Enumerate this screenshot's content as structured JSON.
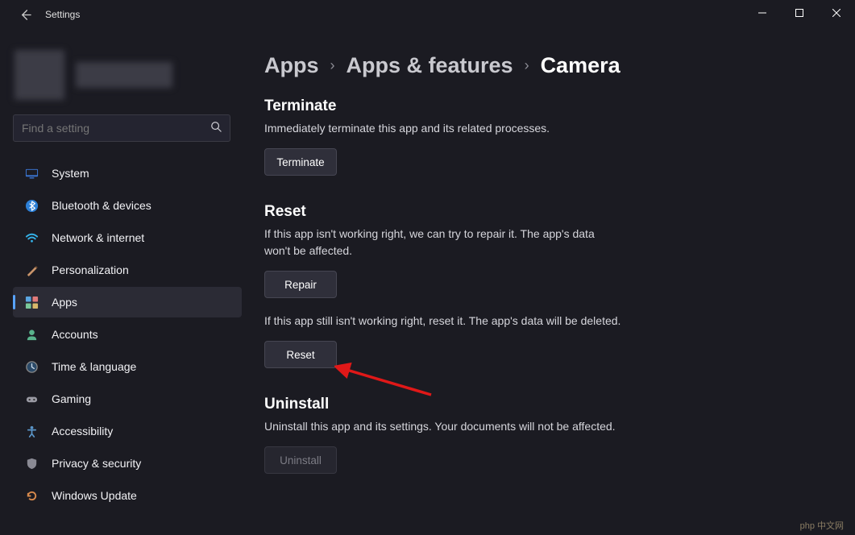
{
  "window": {
    "title": "Settings"
  },
  "search": {
    "placeholder": "Find a setting"
  },
  "nav": {
    "items": [
      {
        "label": "System",
        "icon": "monitor-icon"
      },
      {
        "label": "Bluetooth & devices",
        "icon": "bluetooth-icon"
      },
      {
        "label": "Network & internet",
        "icon": "wifi-icon"
      },
      {
        "label": "Personalization",
        "icon": "brush-icon"
      },
      {
        "label": "Apps",
        "icon": "apps-icon",
        "active": true
      },
      {
        "label": "Accounts",
        "icon": "person-icon"
      },
      {
        "label": "Time & language",
        "icon": "clock-globe-icon"
      },
      {
        "label": "Gaming",
        "icon": "gamepad-icon"
      },
      {
        "label": "Accessibility",
        "icon": "accessibility-icon"
      },
      {
        "label": "Privacy & security",
        "icon": "shield-icon"
      },
      {
        "label": "Windows Update",
        "icon": "update-icon"
      }
    ]
  },
  "breadcrumb": {
    "items": [
      "Apps",
      "Apps & features",
      "Camera"
    ]
  },
  "sections": {
    "terminate": {
      "title": "Terminate",
      "desc": "Immediately terminate this app and its related processes.",
      "button": "Terminate"
    },
    "reset": {
      "title": "Reset",
      "repair_desc": "If this app isn't working right, we can try to repair it. The app's data won't be affected.",
      "repair_button": "Repair",
      "reset_desc": "If this app still isn't working right, reset it. The app's data will be deleted.",
      "reset_button": "Reset"
    },
    "uninstall": {
      "title": "Uninstall",
      "desc": "Uninstall this app and its settings. Your documents will not be affected.",
      "button": "Uninstall"
    }
  },
  "watermark": "php 中文网"
}
